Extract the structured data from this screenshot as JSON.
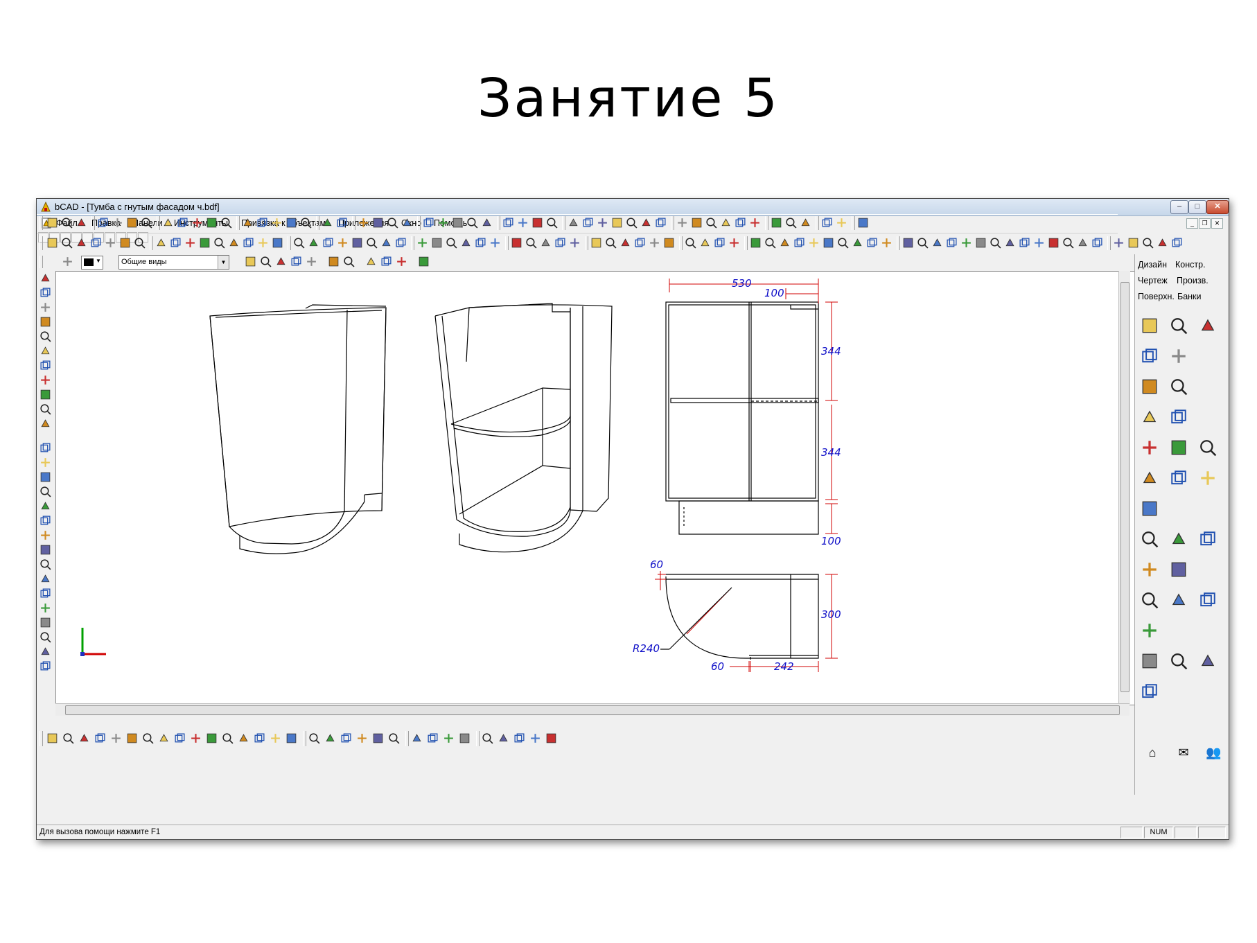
{
  "slide": {
    "title": "Занятие 5"
  },
  "window": {
    "title": "bCAD - [Тумба с гнутым фасадом ч.bdf]",
    "controls": {
      "minimize": "–",
      "maximize": "□",
      "close": "✕"
    }
  },
  "menu": {
    "items": [
      "Файл",
      "Правка",
      "Панели",
      "Инструменты",
      "Привязка к объектам",
      "Приложения",
      "Окно",
      "Помощь"
    ]
  },
  "view_selector": {
    "value": "Общие виды"
  },
  "right_panel": {
    "tabs": [
      "Дизайн",
      "Констр.",
      "Чертеж",
      "Произв.",
      "Поверхн.",
      "Банки"
    ]
  },
  "drawing": {
    "dimensions": [
      "530",
      "100",
      "344",
      "344",
      "100",
      "60",
      "300",
      "R240",
      "60",
      "242"
    ]
  },
  "status": {
    "help": "Для вызова помощи нажмите F1",
    "num": "NUM"
  },
  "colors": {
    "title_bar": "#c7d7ea",
    "dim_color": "#0000cc",
    "dim_line_color": "#d00000",
    "icon_yellow": "#e8c858"
  }
}
